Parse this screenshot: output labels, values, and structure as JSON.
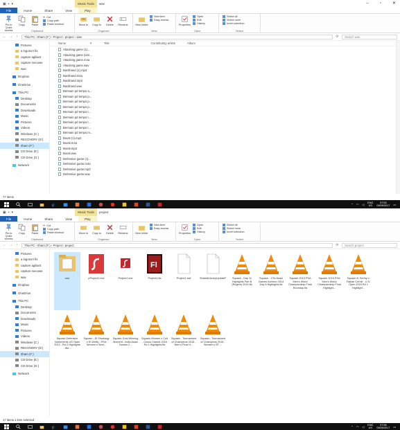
{
  "top_window": {
    "title": "wav",
    "context_tab": "Music Tools",
    "tabs": [
      "File",
      "Home",
      "Share",
      "View",
      "Play"
    ],
    "ribbon": {
      "clipboard": {
        "name": "Clipboard",
        "pin": "Pin to Quick access",
        "copy": "Copy",
        "paste": "Paste",
        "cut": "Cut",
        "copy_path": "Copy path",
        "paste_shortcut": "Paste shortcut"
      },
      "organize": {
        "name": "Organize",
        "move_to": "Move to",
        "copy_to": "Copy to",
        "delete": "Delete",
        "rename": "Rename"
      },
      "new": {
        "name": "New",
        "new_folder": "New folder",
        "new_item": "New item",
        "easy_access": "Easy access"
      },
      "open": {
        "name": "Open",
        "properties": "Properties",
        "open": "Open",
        "edit": "Edit",
        "history": "History"
      },
      "select": {
        "name": "Select",
        "select_all": "Select all",
        "select_none": "Select none",
        "invert": "Invert selection"
      }
    },
    "path": "This PC  ›  Itham (F:)  ›  Project  ›  project  ›  wav",
    "search_placeholder": "Search wav",
    "columns": [
      "Name",
      "#",
      "Title",
      "Contributing artists",
      "Album"
    ],
    "nav": [
      {
        "label": "Pictures",
        "kind": "b",
        "top": false
      },
      {
        "label": "a logoncrt fis",
        "kind": "y",
        "top": false
      },
      {
        "label": "capture agiliant",
        "kind": "y",
        "top": false
      },
      {
        "label": "capture mecowe",
        "kind": "y",
        "top": false
      },
      {
        "label": "wav",
        "kind": "y",
        "top": false
      },
      {
        "label": "Dropbox",
        "kind": "b",
        "top": true
      },
      {
        "label": "OneDrive",
        "kind": "b",
        "top": true
      },
      {
        "label": "This PC",
        "kind": "b",
        "top": true
      },
      {
        "label": "Desktop",
        "kind": "b",
        "top": false
      },
      {
        "label": "Documents",
        "kind": "g",
        "top": false
      },
      {
        "label": "Downloads",
        "kind": "b",
        "top": false
      },
      {
        "label": "Music",
        "kind": "b",
        "top": false
      },
      {
        "label": "Pictures",
        "kind": "b",
        "top": false
      },
      {
        "label": "Videos",
        "kind": "b",
        "top": false
      },
      {
        "label": "Windows (C:)",
        "kind": "g",
        "top": false
      },
      {
        "label": "RECOVERY (D:)",
        "kind": "g",
        "top": false
      },
      {
        "label": "Itham (F:)",
        "kind": "g",
        "top": false,
        "sel": true
      },
      {
        "label": "CD Drive (E:)",
        "kind": "g",
        "top": false
      },
      {
        "label": "CD Drive (G:)",
        "kind": "g",
        "top": false
      },
      {
        "label": "Network",
        "kind": "p",
        "top": true
      }
    ],
    "files": [
      "Attacking game (1)...",
      "Attacking game (tem...",
      "Attacking game.m4a",
      "Attacking game.wav",
      "Backhand (1).mp3",
      "Backhand.m4a",
      "Backhand.mp3",
      "Backhand.wav",
      "Bermain pd tempo a...",
      "Bermain pd tempo p...",
      "Bermain pd tempo p...",
      "Bermain pd tempo p...",
      "Bermain pd tempo t...",
      "Bermain pd tempo t...",
      "Bermain pd tempo t...",
      "Bermain pd tempo t...",
      "Bermain pd tempo.m...",
      "Boost (1).mp3",
      "Boost.m4a",
      "Boost.mp3",
      "Boost.wav",
      "Defensive game (1)...",
      "Defensive game.m4a",
      "Defensive game.mp3",
      "Defensive game.wav"
    ],
    "status": "77 items",
    "taskbar": {
      "lang1": "ENG",
      "lang2": "US",
      "time": "07:53",
      "date": "09/09/2017"
    }
  },
  "bottom_window": {
    "title": "project",
    "context_tab": "Music Tools",
    "tabs": [
      "File",
      "Home",
      "Share",
      "View",
      "Play"
    ],
    "path": "This PC  ›  Itham (F:)  ›  Project  ›  project",
    "search_placeholder": "Search project",
    "nav": [
      {
        "label": "Pictures",
        "kind": "b",
        "top": false
      },
      {
        "label": "a logoncrt fis",
        "kind": "y",
        "top": false
      },
      {
        "label": "capture agiliant",
        "kind": "y",
        "top": false
      },
      {
        "label": "capture mecowe",
        "kind": "y",
        "top": false
      },
      {
        "label": "wav",
        "kind": "y",
        "top": false
      },
      {
        "label": "Dropbox",
        "kind": "b",
        "top": true
      },
      {
        "label": "OneDrive",
        "kind": "b",
        "top": true
      },
      {
        "label": "This PC",
        "kind": "b",
        "top": true
      },
      {
        "label": "Desktop",
        "kind": "b",
        "top": false
      },
      {
        "label": "Documents",
        "kind": "g",
        "top": false
      },
      {
        "label": "Downloads",
        "kind": "b",
        "top": false
      },
      {
        "label": "Music",
        "kind": "b",
        "top": false
      },
      {
        "label": "Pictures",
        "kind": "b",
        "top": false
      },
      {
        "label": "Videos",
        "kind": "b",
        "top": false
      },
      {
        "label": "Windows (C:)",
        "kind": "g",
        "top": false
      },
      {
        "label": "RECOVERY (D:)",
        "kind": "g",
        "top": false
      },
      {
        "label": "Itham (F:)",
        "kind": "g",
        "top": false,
        "sel": true
      },
      {
        "label": "CD Drive (E:)",
        "kind": "g",
        "top": false
      },
      {
        "label": "CD Drive (G:)",
        "kind": "g",
        "top": false
      },
      {
        "label": "Network",
        "kind": "p",
        "top": true
      }
    ],
    "items": [
      {
        "label": "wav",
        "icon": "folder",
        "sel": true
      },
      {
        "label": "pProject1.exe",
        "icon": "flash"
      },
      {
        "label": "Project1.exe",
        "icon": "flash-small"
      },
      {
        "label": "Project1.fla",
        "icon": "fl"
      },
      {
        "label": "Project1.swf",
        "icon": "doc"
      },
      {
        "label": "SharedLibraryUpdatePanelFullInfo.swf",
        "icon": "doc"
      },
      {
        "label": "Squash - Day 11 Highlights Part B (Rogers) 2014.fla",
        "icon": "vlc"
      },
      {
        "label": "Squash - 17th Asian Games Incheon 2014 Day 6 Highlights.fla",
        "icon": "vlc"
      },
      {
        "label": "Squash 2013 PSA Men's World Championship Final Roundup.fla",
        "icon": "vlc"
      },
      {
        "label": "Squash 2015 PSA Men's World Championship Final Highlight...",
        "icon": "vlc"
      },
      {
        "label": "Squash ft. Serhiy v. Fabian Cerhle - U.S. Open 2016 Rd 1 Highlight...",
        "icon": "vlc"
      },
      {
        "label": "Squash Defensive Instruments US Open 2013 - Rd 2 Highlights - We...",
        "icon": "vlc"
      },
      {
        "label": "Squash - El Shorbagy v El Welily - PSA Women s Worl...",
        "icon": "vlc"
      },
      {
        "label": "Squash Gold Winning Moment - India Asian Games 2...",
        "icon": "vlc"
      },
      {
        "label": "Squash Women v Colt - Cusco Classic 2016 Rd 1 Highlights.fla",
        "icon": "vlc"
      },
      {
        "label": "Squash - Tournament of Champions 2016 - Men s Final H...",
        "icon": "vlc"
      },
      {
        "label": "Squash - Tournament of Champions 2016 - Women s SF ...",
        "icon": "vlc"
      }
    ],
    "status": "17 items   1 item selected",
    "taskbar": {
      "lang1": "ENG",
      "lang2": "US",
      "time": "07:58",
      "date": "09/09/2017"
    }
  },
  "colors": {
    "file_tab": "#1e62b8",
    "context_tab": "#f3e49a",
    "taskbar": "#101010",
    "selected": "#cce8ff",
    "vlc": "#f08a0b"
  }
}
